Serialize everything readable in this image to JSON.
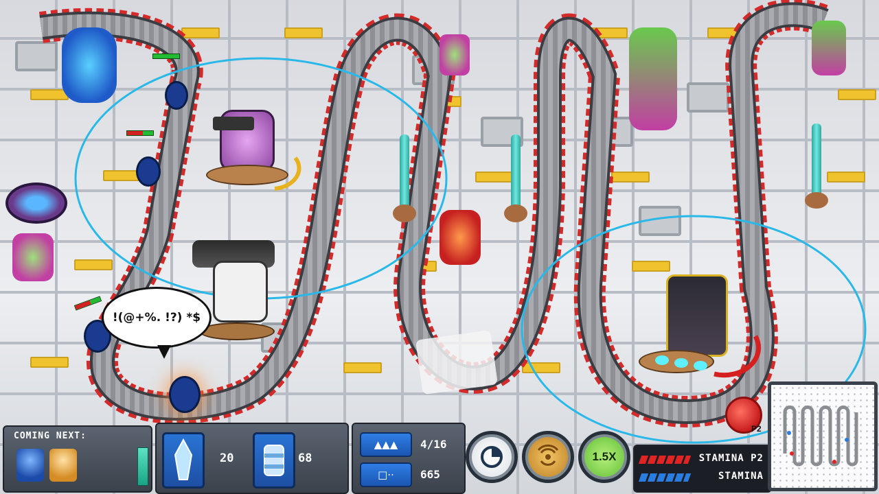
{
  "speech_bubble": {
    "text": "!(@+%. !?) *$"
  },
  "hud": {
    "coming_next": {
      "label": "COMING NEXT:",
      "units": [
        "blue-armored-warrior-icon",
        "fox-creature-icon"
      ]
    },
    "resources": [
      {
        "icon": "crystal-icon",
        "value": "20"
      },
      {
        "icon": "canister-icon",
        "value": "68"
      }
    ],
    "counters": [
      {
        "icon": "enemy-group-icon",
        "value": "4/16"
      },
      {
        "icon": "card-icon",
        "value": "665"
      }
    ],
    "buttons": {
      "speed_label": "1.5X"
    },
    "stamina": {
      "p2_label": "STAMINA P2",
      "p1_label": "STAMINA"
    },
    "p2_marker": "P2"
  },
  "colors": {
    "range_circle": "#2ab8e8",
    "track_rail": "#d42a2a",
    "stamina_p2": "#e02424",
    "stamina_p1": "#2a7de0",
    "speed_button": "#7ed957",
    "pad_yellow": "#f0c22e"
  }
}
